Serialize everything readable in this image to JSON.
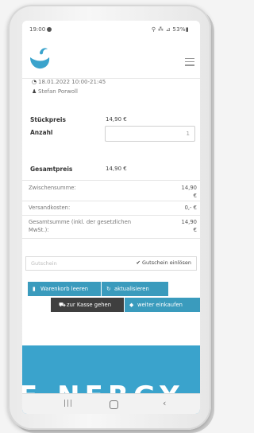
{
  "status_bar": {
    "time": "19:00",
    "right": "⚲ ⁂ ⊿ 53%▮"
  },
  "order": {
    "date_line": "18.01.2022 10:00-21:45",
    "person": "Stefan Porwoll"
  },
  "item": {
    "unit_price_label": "Stückpreis",
    "unit_price_value": "14,90 €",
    "qty_label": "Anzahl",
    "qty_value": "1",
    "total_label": "Gesamtpreis",
    "total_value": "14,90 €"
  },
  "summary": {
    "subtotal_label": "Zwischensumme:",
    "subtotal_amount": "14,90",
    "subtotal_currency": "€",
    "shipping_label": "Versandkosten:",
    "shipping_amount": "0,- €",
    "grand_label_1": "Gesamtsumme (inkl. der gesetzlichen",
    "grand_label_2": "MwSt.):",
    "grand_amount": "14,90",
    "grand_currency": "€"
  },
  "coupon": {
    "placeholder": "Gutschein",
    "button": "Gutschein einlösen"
  },
  "buttons": {
    "clear_cart": "Warenkorb leeren",
    "update": "aktualisieren",
    "checkout": "zur Kasse gehen",
    "continue": "weiter einkaufen"
  },
  "banner": {
    "text": "E·NERGY"
  },
  "colors": {
    "accent": "#3a9bbd",
    "dark_button": "#3f3f3f",
    "banner": "#3aa3cc"
  }
}
